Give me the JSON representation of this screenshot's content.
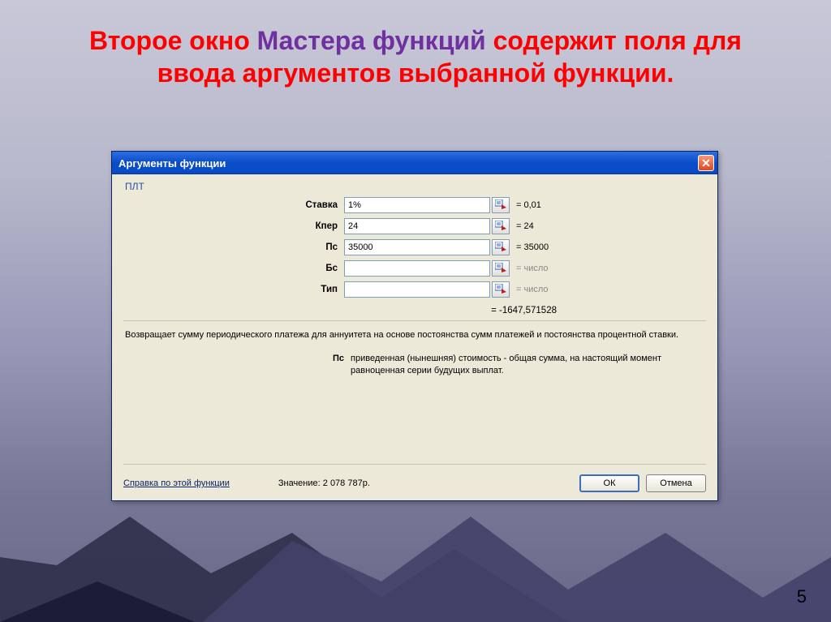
{
  "slide": {
    "heading_pre": "Второе окно ",
    "heading_emph": "Мастера функций",
    "heading_post": " содержит поля для ввода аргументов выбранной функции."
  },
  "dialog": {
    "title": "Аргументы функции",
    "function_name": "ПЛТ",
    "arguments": [
      {
        "label": "Ставка",
        "value": "1%",
        "result": "= 0,01",
        "dim": false
      },
      {
        "label": "Кпер",
        "value": "24",
        "result": "= 24",
        "dim": false
      },
      {
        "label": "Пс",
        "value": "35000",
        "result": "= 35000",
        "dim": false
      },
      {
        "label": "Бс",
        "value": "",
        "result": "= число",
        "dim": true
      },
      {
        "label": "Тип",
        "value": "",
        "result": "= число",
        "dim": true
      }
    ],
    "overall_result": "= -1647,571528",
    "description_main": "Возвращает сумму периодического платежа для аннуитета на основе постоянства сумм платежей и постоянства процентной ставки.",
    "param_label": "Пс",
    "param_desc": "приведенная (нынешняя) стоимость - общая сумма, на настоящий момент равноценная серии будущих выплат.",
    "help_link": "Справка по этой функции",
    "value_label": "Значение:",
    "value_text": "2 078 787р.",
    "ok_label": "ОК",
    "cancel_label": "Отмена"
  },
  "page_number": "5"
}
